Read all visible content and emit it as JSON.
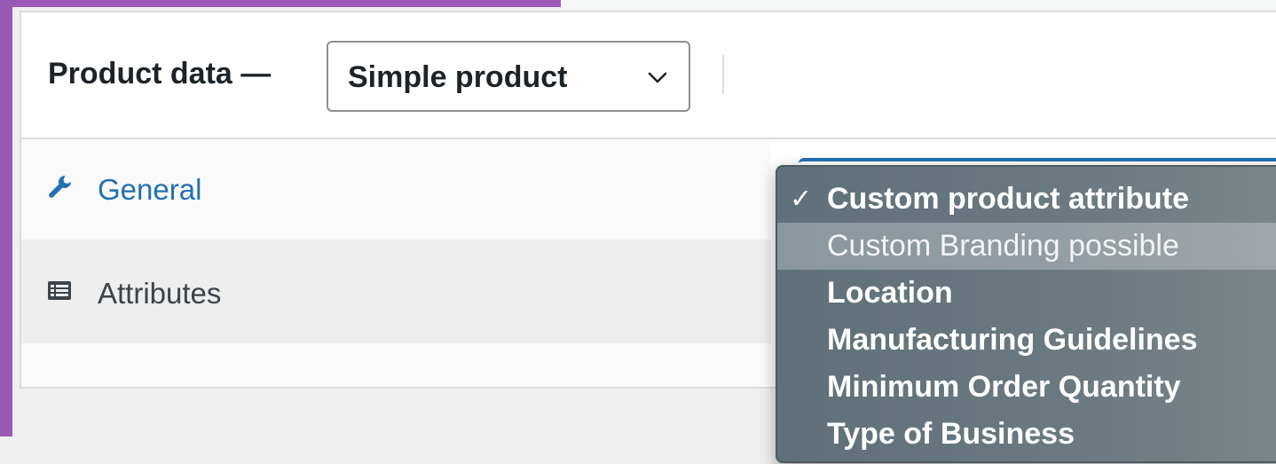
{
  "panel": {
    "title": "Product data —",
    "product_type": {
      "selected": "Simple product"
    }
  },
  "tabs": [
    {
      "label": "General",
      "icon": "wrench-icon",
      "active": true
    },
    {
      "label": "Attributes",
      "icon": "list-icon",
      "active": false
    }
  ],
  "attribute_menu": {
    "items": [
      {
        "label": "Custom product attribute",
        "checked": true,
        "hover": false
      },
      {
        "label": "Custom Branding possible",
        "checked": false,
        "hover": true
      },
      {
        "label": "Location",
        "checked": false,
        "hover": false
      },
      {
        "label": "Manufacturing Guidelines",
        "checked": false,
        "hover": false
      },
      {
        "label": "Minimum Order Quantity",
        "checked": false,
        "hover": false
      },
      {
        "label": "Type of Business",
        "checked": false,
        "hover": false
      }
    ],
    "check_glyph": "✓"
  },
  "colors": {
    "admin_accent": "#9b59b6",
    "link_blue": "#2271b1",
    "menu_bg": "#66747c"
  }
}
